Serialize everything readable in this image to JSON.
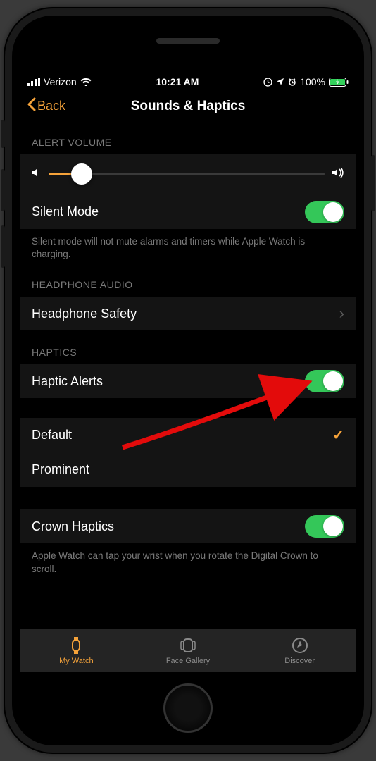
{
  "statusbar": {
    "carrier": "Verizon",
    "time": "10:21 AM",
    "battery": "100%"
  },
  "nav": {
    "back": "Back",
    "title": "Sounds & Haptics"
  },
  "sections": {
    "alert_volume": {
      "header": "ALERT VOLUME",
      "slider_value_pct": 12
    },
    "silent_mode": {
      "label": "Silent Mode",
      "footer": "Silent mode will not mute alarms and timers while Apple Watch is charging."
    },
    "headphone": {
      "header": "HEADPHONE AUDIO",
      "safety_label": "Headphone Safety"
    },
    "haptics": {
      "header": "HAPTICS",
      "alerts_label": "Haptic Alerts",
      "default_label": "Default",
      "prominent_label": "Prominent"
    },
    "crown": {
      "label": "Crown Haptics",
      "footer": "Apple Watch can tap your wrist when you rotate the Digital Crown to scroll."
    }
  },
  "tabs": {
    "my_watch": "My Watch",
    "face_gallery": "Face Gallery",
    "discover": "Discover"
  }
}
